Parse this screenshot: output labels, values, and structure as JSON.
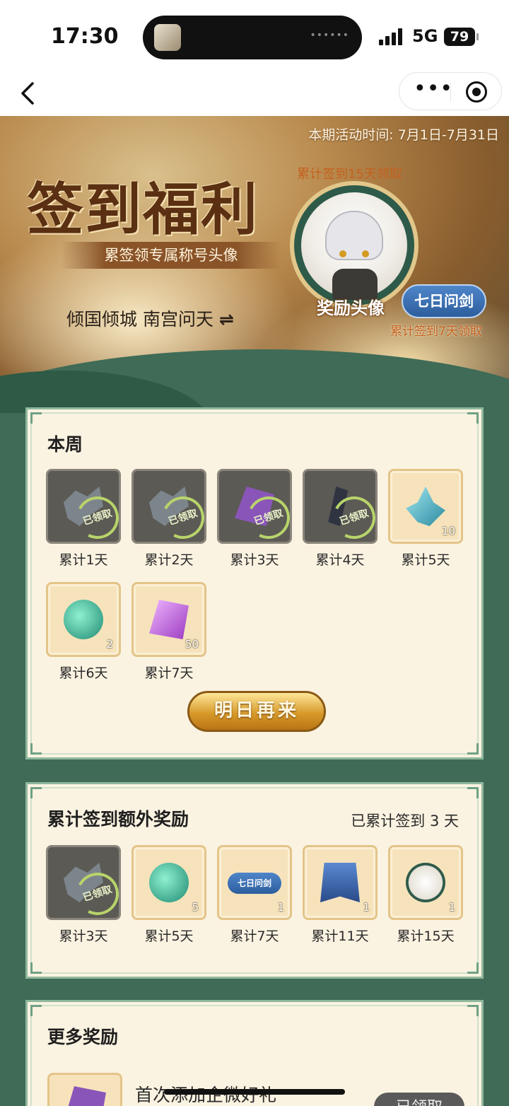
{
  "status_bar": {
    "time": "17:30",
    "network": "5G",
    "battery": "79"
  },
  "nav": {
    "back_icon": "chevron-left-icon",
    "more_icon": "more-dots-icon",
    "close_icon": "target-circle-icon"
  },
  "banner": {
    "period": "本期活动时间: 7月1日-7月31日",
    "title": "签到福利",
    "subtitle": "累签领专属称号头像",
    "nickname": "倾国倾城 南宫问天",
    "swap_symbol": "⇌",
    "hint_15": "累计签到15天领取",
    "avatar_label": "奖励头像",
    "title_badge": "七日问剑",
    "hint_7": "累计签到7天领取"
  },
  "week": {
    "title": "本周",
    "claimed_text": "已领取",
    "items": [
      {
        "label": "累计1天",
        "icon": "scrap-metal-icon",
        "claimed": true,
        "count": ""
      },
      {
        "label": "累计2天",
        "icon": "scrap-metal-icon",
        "claimed": true,
        "count": ""
      },
      {
        "label": "累计3天",
        "icon": "purple-stone-icon",
        "claimed": true,
        "count": ""
      },
      {
        "label": "累计4天",
        "icon": "dark-slab-icon",
        "claimed": true,
        "count": ""
      },
      {
        "label": "累计5天",
        "icon": "blue-crystal-icon",
        "claimed": false,
        "count": "10"
      },
      {
        "label": "累计6天",
        "icon": "green-pouch-icon",
        "claimed": false,
        "count": "2"
      },
      {
        "label": "累计7天",
        "icon": "purple-gem-icon",
        "claimed": false,
        "count": "50"
      }
    ],
    "button": "明日再来"
  },
  "bonus": {
    "title": "累计签到额外奖励",
    "progress": "已累计签到 3 天",
    "items": [
      {
        "label": "累计3天",
        "icon": "scrap-metal-icon",
        "claimed": true,
        "count": ""
      },
      {
        "label": "累计5天",
        "icon": "green-pouch-icon",
        "claimed": false,
        "count": "5"
      },
      {
        "label": "累计7天",
        "icon": "title-badge-icon",
        "claimed": false,
        "count": "1",
        "badge_text": "七日问剑"
      },
      {
        "label": "累计11天",
        "icon": "blue-cape-icon",
        "claimed": false,
        "count": "1"
      },
      {
        "label": "累计15天",
        "icon": "avatar-frame-icon",
        "claimed": false,
        "count": "1"
      }
    ]
  },
  "more": {
    "title": "更多奖励",
    "first_item_text": "首次添加企微好礼",
    "first_item_button": "已领取"
  }
}
